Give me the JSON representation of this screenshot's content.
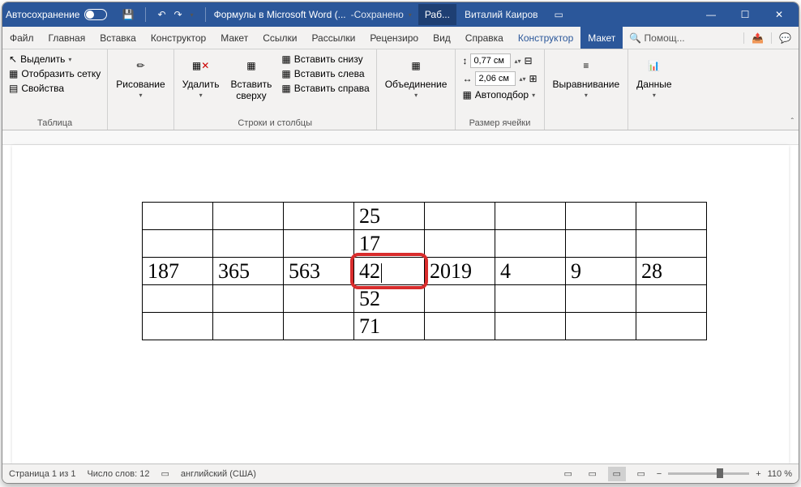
{
  "titlebar": {
    "autosave": "Автосохранение",
    "doc_title": "Формулы в Microsoft Word (...",
    "saved_status": "Сохранено",
    "active_tab": "Раб...",
    "user": "Виталий Каиров"
  },
  "menus": {
    "file": "Файл",
    "home": "Главная",
    "insert": "Вставка",
    "design": "Конструктор",
    "layout": "Макет",
    "references": "Ссылки",
    "mailings": "Рассылки",
    "review": "Рецензиро",
    "view": "Вид",
    "help": "Справка",
    "table_design": "Конструктор",
    "table_layout": "Макет",
    "tell_me": "Помощ..."
  },
  "ribbon": {
    "table_group": {
      "select": "Выделить",
      "gridlines": "Отобразить сетку",
      "properties": "Свойства",
      "label": "Таблица"
    },
    "draw_group": {
      "draw": "Рисование"
    },
    "delete": "Удалить",
    "insert_above": "Вставить\nсверху",
    "rows_cols": {
      "below": "Вставить снизу",
      "left": "Вставить слева",
      "right": "Вставить справа",
      "label": "Строки и столбцы"
    },
    "merge": "Объединение",
    "cell_size": {
      "height": "0,77 см",
      "width": "2,06 см",
      "autofit": "Автоподбор",
      "label": "Размер ячейки"
    },
    "alignment": "Выравнивание",
    "data": "Данные"
  },
  "table": {
    "rows": [
      [
        "",
        "",
        "",
        "25",
        "",
        "",
        "",
        ""
      ],
      [
        "",
        "",
        "",
        "17",
        "",
        "",
        "",
        ""
      ],
      [
        "187",
        "365",
        "563",
        "42",
        "2019",
        "4",
        "9",
        "28"
      ],
      [
        "",
        "",
        "",
        "52",
        "",
        "",
        "",
        ""
      ],
      [
        "",
        "",
        "",
        "71",
        "",
        "",
        "",
        ""
      ]
    ],
    "highlighted": [
      2,
      3
    ]
  },
  "statusbar": {
    "page": "Страница 1 из 1",
    "words": "Число слов: 12",
    "language": "английский (США)",
    "zoom": "110 %"
  },
  "chart_data": {
    "type": "table",
    "rows": [
      [
        "",
        "",
        "",
        "25",
        "",
        "",
        "",
        ""
      ],
      [
        "",
        "",
        "",
        "17",
        "",
        "",
        "",
        ""
      ],
      [
        "187",
        "365",
        "563",
        "42",
        "2019",
        "4",
        "9",
        "28"
      ],
      [
        "",
        "",
        "",
        "52",
        "",
        "",
        "",
        ""
      ],
      [
        "",
        "",
        "",
        "71",
        "",
        "",
        "",
        ""
      ]
    ]
  }
}
